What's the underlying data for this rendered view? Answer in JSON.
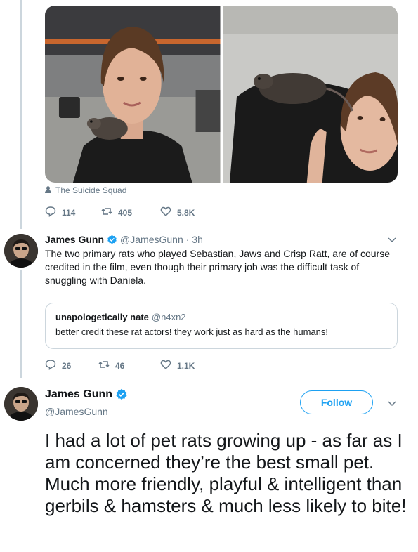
{
  "photo_tag": {
    "icon": "person-icon",
    "label": "The Suicide Squad"
  },
  "first_actions": {
    "replies": "114",
    "retweets": "405",
    "likes": "5.8K"
  },
  "reply_tweet": {
    "author_name": "James Gunn",
    "author_handle": "@JamesGunn",
    "time": "· 3h",
    "text": "The two primary rats who played Sebastian, Jaws and Crisp Ratt, are of course credited in the film, even though their primary job was the difficult task of snuggling with Daniela.",
    "quoted": {
      "name": "unapologetically nate",
      "handle": "@n4xn2",
      "text": "better credit these rat actors! they work just as hard as the humans!"
    },
    "actions": {
      "replies": "26",
      "retweets": "46",
      "likes": "1.1K"
    }
  },
  "main_tweet": {
    "author_name": "James Gunn",
    "author_handle": "@JamesGunn",
    "follow_label": "Follow",
    "text": "I had a lot of pet rats growing up - as far as I am concerned they’re the best small pet. Much more friendly, playful & intelligent than gerbils & hamsters & much less likely to bite!"
  },
  "colors": {
    "accent": "#1da1f2",
    "muted": "#657786",
    "border": "#ccd6dd",
    "text": "#14171a"
  }
}
